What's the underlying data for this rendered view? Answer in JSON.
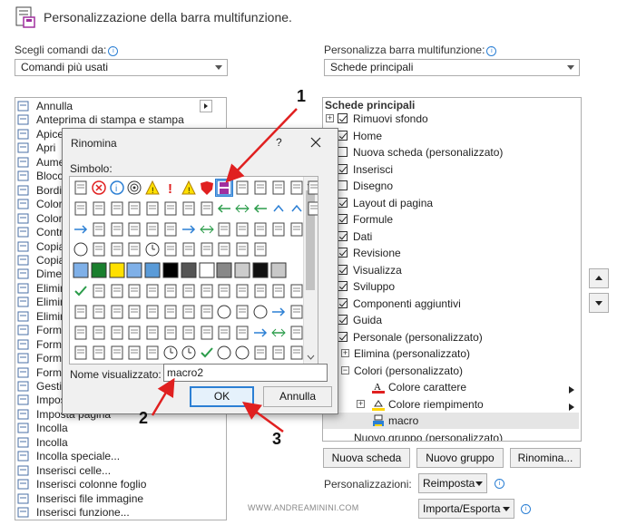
{
  "header": {
    "title": "Personalizzazione della barra multifunzione."
  },
  "left": {
    "label": "Scegli comandi da:",
    "combo": "Comandi più usati",
    "items": [
      "Annulla",
      "Anteprima di stampa e stampa",
      "Apice",
      "Apri",
      "Aumenta",
      "Blocca",
      "Bordi",
      "Colore",
      "Colore",
      "Controllo",
      "Copia",
      "Copia",
      "Dimensione",
      "Elimina",
      "Elimina",
      "Elimina",
      "Formato",
      "Formato",
      "Formato",
      "Formato",
      "Gestione",
      "Imposta",
      "Imposta pagina",
      "Incolla",
      "Incolla",
      "Incolla speciale...",
      "Inserisci celle...",
      "Inserisci colonne foglio",
      "Inserisci file immagine",
      "Inserisci funzione..."
    ]
  },
  "right": {
    "label": "Personalizza barra multifunzione:",
    "combo": "Schede principali",
    "tree_header": "Schede principali",
    "items": [
      {
        "label": "Rimuovi sfondo",
        "indent": 0,
        "checkbox": true,
        "expander": "+"
      },
      {
        "label": "Home",
        "indent": 0,
        "checkbox": true
      },
      {
        "label": "Nuova scheda (personalizzato)",
        "indent": 0,
        "checkbox": false
      },
      {
        "label": "Inserisci",
        "indent": 0,
        "checkbox": true
      },
      {
        "label": "Disegno",
        "indent": 0,
        "checkbox": false
      },
      {
        "label": "Layout di pagina",
        "indent": 0,
        "checkbox": true
      },
      {
        "label": "Formule",
        "indent": 0,
        "checkbox": true
      },
      {
        "label": "Dati",
        "indent": 0,
        "checkbox": true
      },
      {
        "label": "Revisione",
        "indent": 0,
        "checkbox": true
      },
      {
        "label": "Visualizza",
        "indent": 0,
        "checkbox": true
      },
      {
        "label": "Sviluppo",
        "indent": 0,
        "checkbox": true
      },
      {
        "label": "Componenti aggiuntivi",
        "indent": 0,
        "checkbox": true
      },
      {
        "label": "Guida",
        "indent": 0,
        "checkbox": true
      },
      {
        "label": "Personale (personalizzato)",
        "indent": 0,
        "checkbox": true,
        "expander": "-"
      },
      {
        "label": "Elimina (personalizzato)",
        "indent": 1,
        "expander": "+"
      },
      {
        "label": "Colori (personalizzato)",
        "indent": 1,
        "expander": "-"
      },
      {
        "label": "Colore carattere",
        "indent": 2
      },
      {
        "label": "Colore riempimento",
        "indent": 2,
        "expander": "+"
      },
      {
        "label": "macro",
        "indent": 2,
        "selected": true
      },
      {
        "label": "Nuovo gruppo (personalizzato)",
        "indent": 1
      }
    ],
    "buttons": {
      "new_tab": "Nuova scheda",
      "new_group": "Nuovo gruppo",
      "rename": "Rinomina..."
    },
    "custom_label": "Personalizzazioni:",
    "reset": "Reimposta",
    "import_export": "Importa/Esporta"
  },
  "watermark": "WWW.ANDREAMININI.COM",
  "dialog": {
    "title": "Rinomina",
    "help": "?",
    "symbol_label": "Simbolo:",
    "display_name_label": "Nome visualizzato:",
    "display_name_value": "macro2",
    "ok": "OK",
    "cancel": "Annulla"
  },
  "callouts": [
    "1",
    "2",
    "3"
  ],
  "colors": {
    "selected_bg": "#e5e5e5",
    "dialog_bg": "#f0f0f0",
    "accent_blue": "#2b7fd4",
    "arrow_red": "#e02020",
    "macro_icon": "#a0309f"
  }
}
